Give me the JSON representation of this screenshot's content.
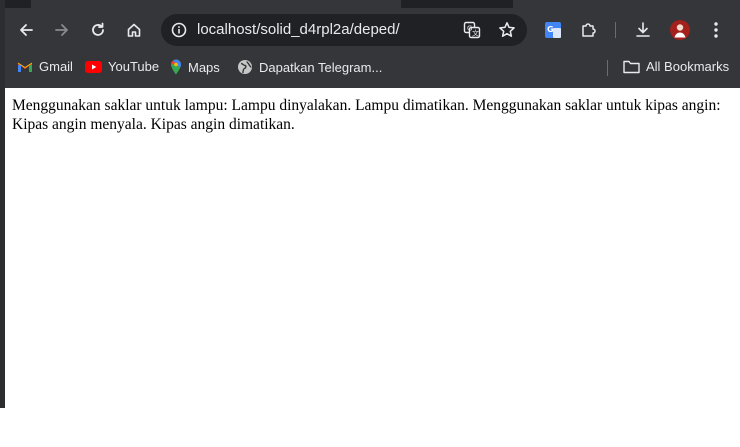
{
  "browser": {
    "url": "localhost/solid_d4rpl2a/deped/",
    "bookmarks": [
      {
        "label": "Gmail",
        "icon": "gmail-icon"
      },
      {
        "label": "YouTube",
        "icon": "youtube-icon"
      },
      {
        "label": "Maps",
        "icon": "maps-icon"
      },
      {
        "label": "Dapatkan Telegram...",
        "icon": "globe-icon"
      }
    ],
    "all_bookmarks_label": "All Bookmarks",
    "colors": {
      "toolbar": "#35363a",
      "omnibox": "#202124",
      "text": "#e8eaed",
      "youtube_red": "#ff0000"
    }
  },
  "page": {
    "body_text": "Menggunakan saklar untuk lampu: Lampu dinyalakan. Lampu dimatikan. Menggunakan saklar untuk kipas angin: Kipas angin menyala. Kipas angin dimatikan."
  }
}
